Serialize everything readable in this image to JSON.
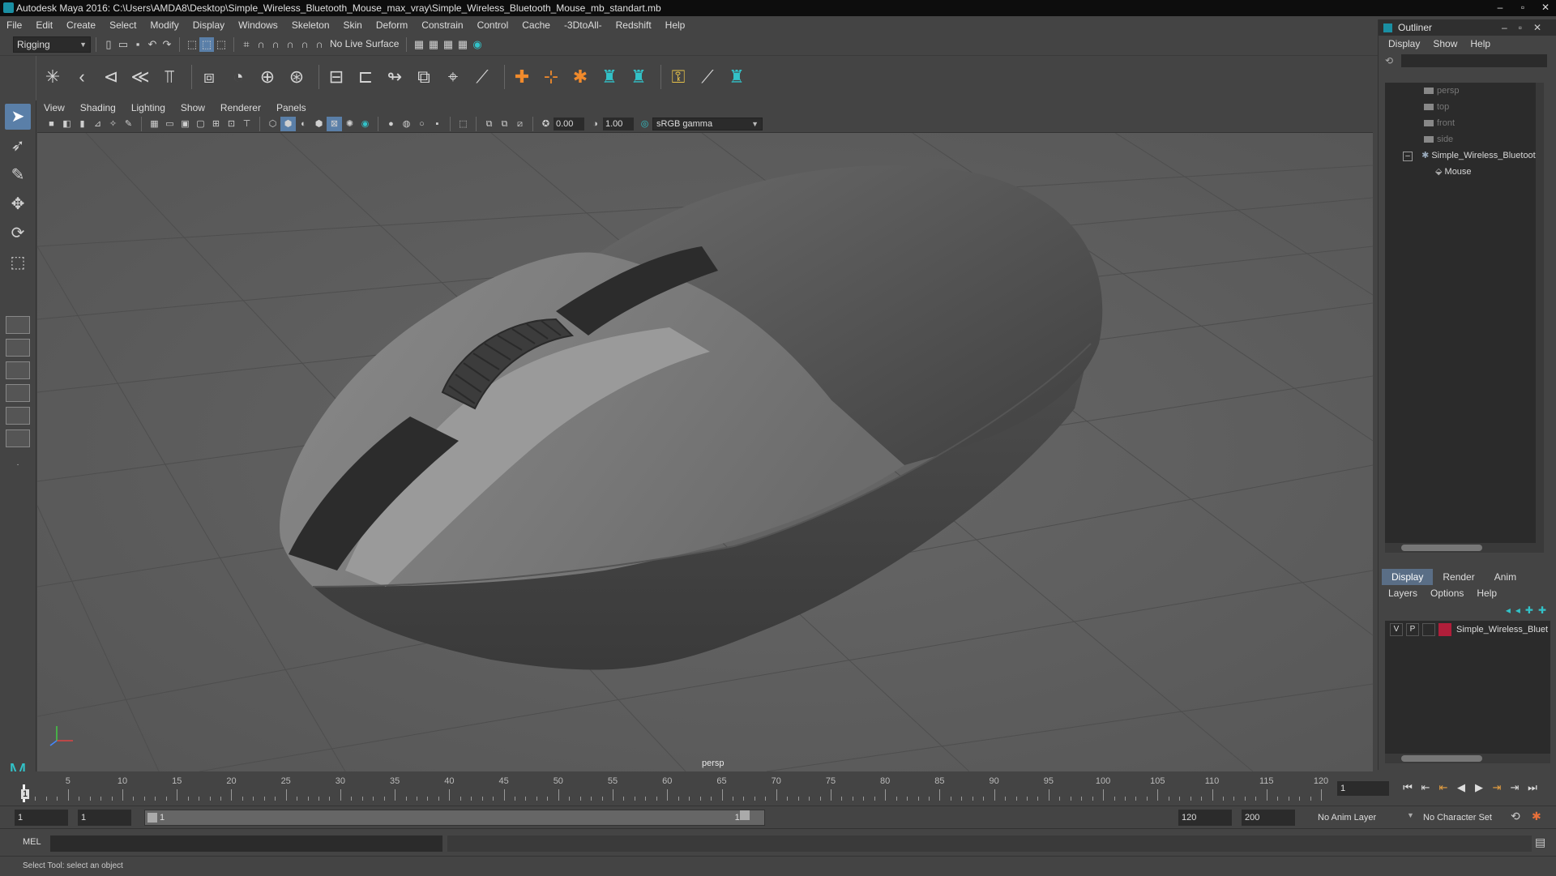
{
  "window": {
    "title": "Autodesk Maya 2016: C:\\Users\\AMDA8\\Desktop\\Simple_Wireless_Bluetooth_Mouse_max_vray\\Simple_Wireless_Bluetooth_Mouse_mb_standart.mb"
  },
  "menubar": [
    "File",
    "Edit",
    "Create",
    "Select",
    "Modify",
    "Display",
    "Windows",
    "Skeleton",
    "Skin",
    "Deform",
    "Constrain",
    "Control",
    "Cache",
    "-3DtoAll-",
    "Redshift",
    "Help"
  ],
  "status": {
    "mode": "Rigging",
    "live_surface": "No Live Surface"
  },
  "viewport": {
    "menus": [
      "View",
      "Shading",
      "Lighting",
      "Show",
      "Renderer",
      "Panels"
    ],
    "exposure": "0.00",
    "gamma": "1.00",
    "color_space": "sRGB gamma",
    "camera_label": "persp"
  },
  "outliner": {
    "title": "Outliner",
    "menus": [
      "Display",
      "Show",
      "Help"
    ],
    "items": [
      {
        "label": "persp",
        "dim": true
      },
      {
        "label": "top",
        "dim": true
      },
      {
        "label": "front",
        "dim": true
      },
      {
        "label": "side",
        "dim": true
      },
      {
        "label": "Simple_Wireless_Bluetoot",
        "dim": false
      },
      {
        "label": "Mouse",
        "dim": false
      }
    ]
  },
  "layers": {
    "tabs": [
      "Display",
      "Render",
      "Anim"
    ],
    "menus": [
      "Layers",
      "Options",
      "Help"
    ],
    "row": {
      "v": "V",
      "p": "P",
      "name": "Simple_Wireless_Bluet",
      "color": "#b01e3a"
    }
  },
  "timeline": {
    "ticks": [
      "5",
      "10",
      "15",
      "20",
      "25",
      "30",
      "35",
      "40",
      "45",
      "50",
      "55",
      "60",
      "65",
      "70",
      "75",
      "80",
      "85",
      "90",
      "95",
      "100",
      "105",
      "110",
      "115",
      "120"
    ],
    "current_frame": "1",
    "current_field": "1"
  },
  "range": {
    "start": "1",
    "start2": "1",
    "bar_start": "1",
    "bar_end": "120",
    "end": "120",
    "end2": "200",
    "anim_layer": "No Anim Layer",
    "character_set": "No Character Set"
  },
  "cmd": {
    "label": "MEL"
  },
  "help": {
    "text": "Select Tool: select an object"
  }
}
